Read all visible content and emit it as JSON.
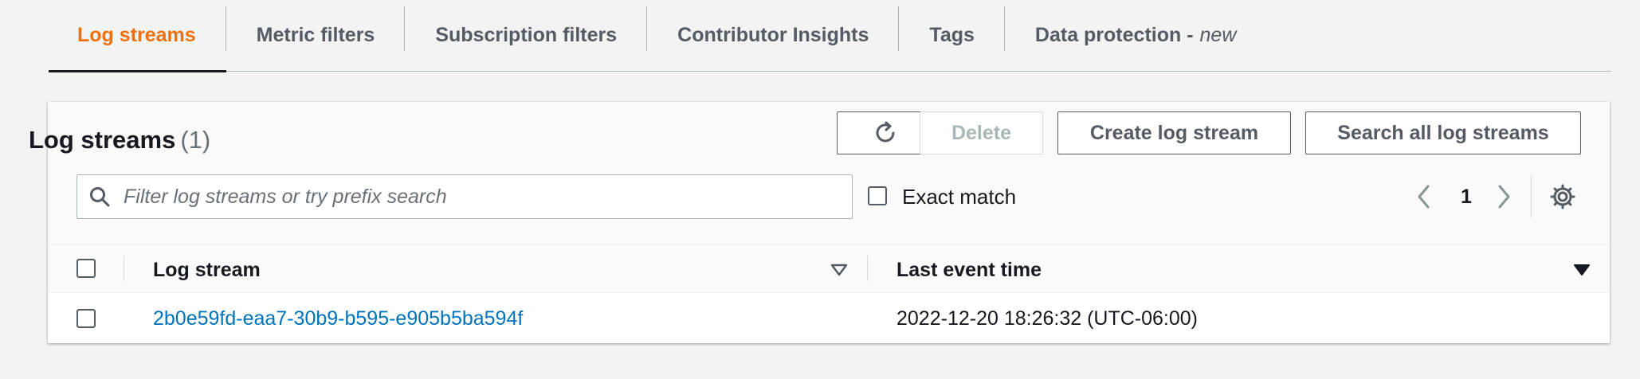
{
  "tabs": [
    {
      "label": "Log streams",
      "suffix": ""
    },
    {
      "label": "Metric filters",
      "suffix": ""
    },
    {
      "label": "Subscription filters",
      "suffix": ""
    },
    {
      "label": "Contributor Insights",
      "suffix": ""
    },
    {
      "label": "Tags",
      "suffix": ""
    },
    {
      "label": "Data protection -",
      "suffix": "new"
    }
  ],
  "panel": {
    "title": "Log streams",
    "count": "(1)"
  },
  "toolbar": {
    "refresh_icon": "refresh-icon",
    "delete_label": "Delete",
    "create_label": "Create log stream",
    "search_all_label": "Search all log streams"
  },
  "filter": {
    "placeholder": "Filter log streams or try prefix search",
    "value": "",
    "exact_match_label": "Exact match"
  },
  "pagination": {
    "current_page": "1"
  },
  "table": {
    "columns": [
      "Log stream",
      "Last event time"
    ],
    "rows": [
      {
        "log_stream": "2b0e59fd-eaa7-30b9-b595-e905b5ba594f",
        "last_event_time": "2022-12-20 18:26:32 (UTC-06:00)"
      }
    ]
  },
  "colors": {
    "accent": "#ec7211",
    "link": "#0073bb",
    "text": "#16191f",
    "secondary": "#545b64"
  }
}
